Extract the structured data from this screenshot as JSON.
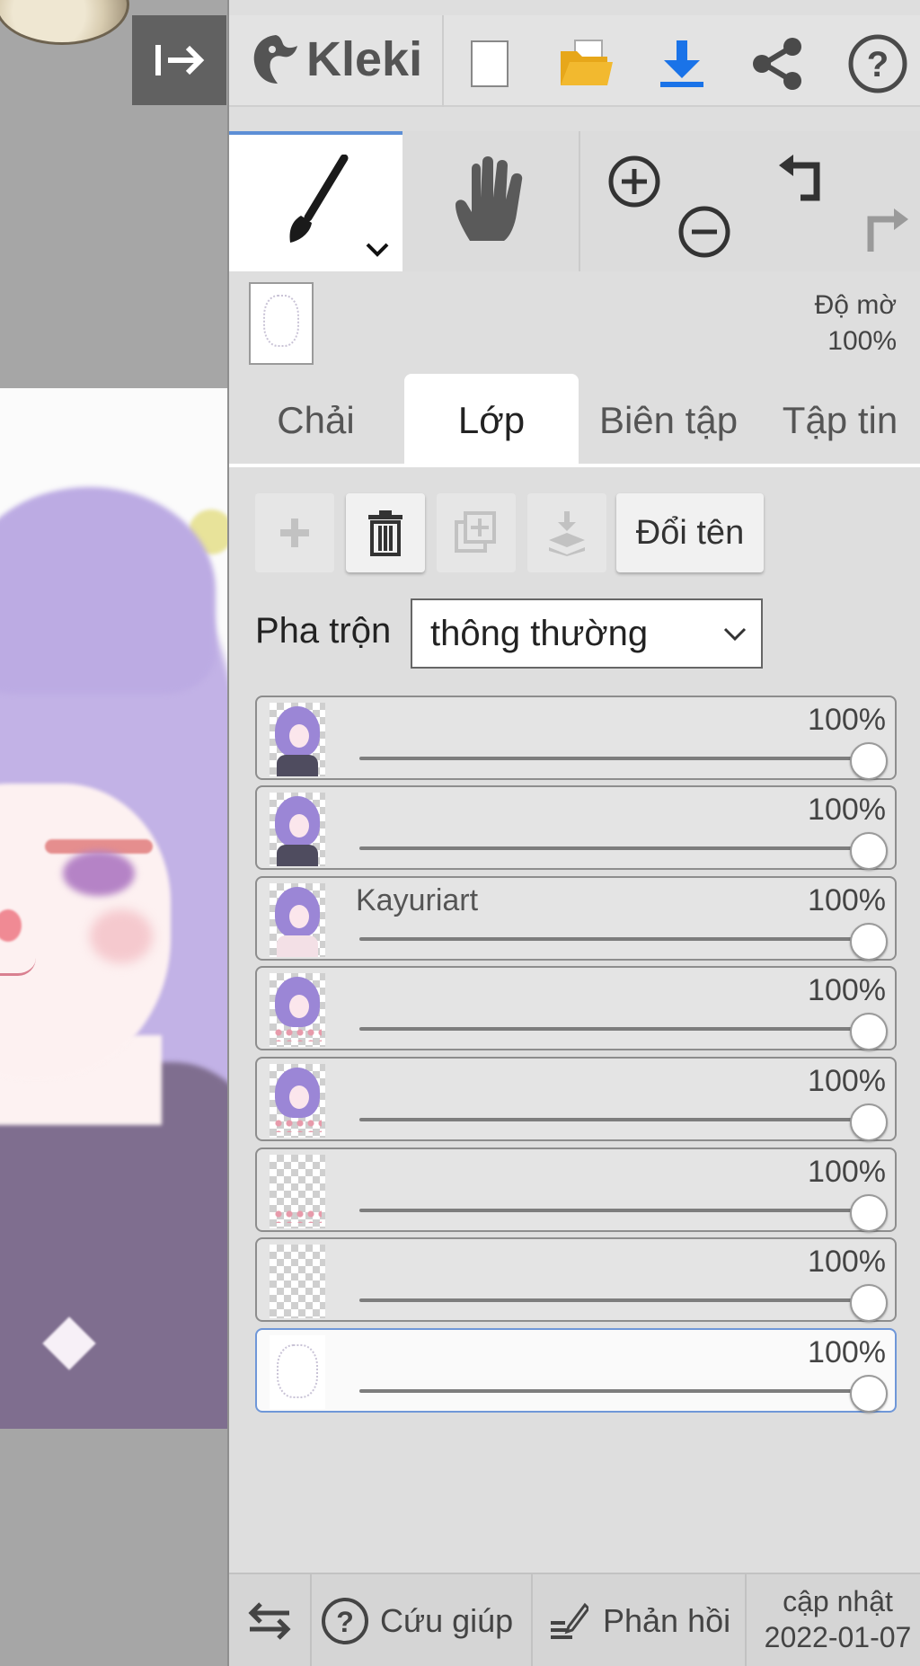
{
  "app": {
    "logo_text": "Kleki"
  },
  "toolbar": {
    "icons": [
      "collapse-panel-icon",
      "kleki-logo-icon",
      "new-file-icon",
      "open-folder-icon",
      "download-icon",
      "share-icon",
      "help-icon"
    ],
    "accent_color": "#1a73e8",
    "folder_color": "#f2b92f"
  },
  "tools": {
    "brush_icon": "brush-icon",
    "hand_icon": "hand-icon",
    "zoom_in_icon": "zoom-in-icon",
    "zoom_out_icon": "zoom-out-icon",
    "undo_icon": "undo-icon",
    "redo_icon": "redo-icon",
    "active_color": "#5d8fd6"
  },
  "opacity": {
    "label": "Độ mờ",
    "value": "100%"
  },
  "tabs": [
    {
      "label": "Chải",
      "active": false
    },
    {
      "label": "Lớp",
      "active": true
    },
    {
      "label": "Biên tập",
      "active": false
    },
    {
      "label": "Tập tin",
      "active": false
    }
  ],
  "layer_actions": {
    "add_icon": "add-layer-icon",
    "delete_icon": "trash-icon",
    "duplicate_icon": "duplicate-layer-icon",
    "merge_icon": "merge-down-icon",
    "rename_label": "Đổi tên"
  },
  "blend": {
    "label": "Pha trộn",
    "selected": "thông thường"
  },
  "layers": [
    {
      "name": "",
      "opacity": "100%",
      "opacity_value": 1.0,
      "thumb": "figure-dark",
      "selected": false
    },
    {
      "name": "",
      "opacity": "100%",
      "opacity_value": 1.0,
      "thumb": "figure-dark",
      "selected": false
    },
    {
      "name": "Kayuriart",
      "opacity": "100%",
      "opacity_value": 1.0,
      "thumb": "figure-pink",
      "selected": false
    },
    {
      "name": "",
      "opacity": "100%",
      "opacity_value": 1.0,
      "thumb": "figure-dots",
      "selected": false
    },
    {
      "name": "",
      "opacity": "100%",
      "opacity_value": 1.0,
      "thumb": "figure-dots",
      "selected": false
    },
    {
      "name": "",
      "opacity": "100%",
      "opacity_value": 1.0,
      "thumb": "checker-dots",
      "selected": false
    },
    {
      "name": "",
      "opacity": "100%",
      "opacity_value": 1.0,
      "thumb": "checker",
      "selected": false
    },
    {
      "name": "",
      "opacity": "100%",
      "opacity_value": 1.0,
      "thumb": "sketch",
      "selected": true
    }
  ],
  "bottom": {
    "swap_icon": "swap-arrows-icon",
    "help_label": "Cứu giúp",
    "feedback_label": "Phản hồi",
    "update_label": "cập nhật",
    "update_date": "2022-01-07"
  }
}
